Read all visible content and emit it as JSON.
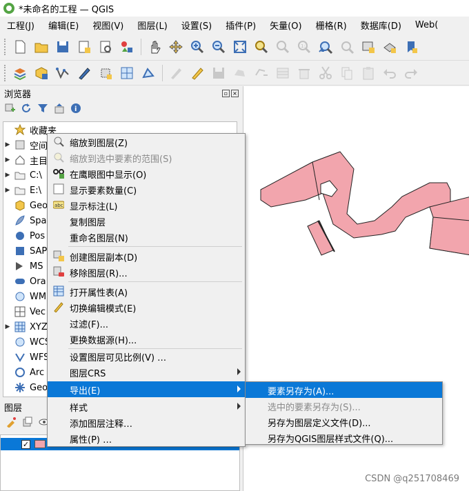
{
  "window": {
    "title": "*未命名的工程 — QGIS"
  },
  "menubar": [
    "工程(J)",
    "编辑(E)",
    "视图(V)",
    "图层(L)",
    "设置(S)",
    "插件(P)",
    "矢量(O)",
    "栅格(R)",
    "数据库(D)",
    "Web("
  ],
  "browser_panel": {
    "title": "浏览器",
    "items": [
      "收藏夹",
      "空间",
      "主目",
      "C:\\",
      "E:\\",
      "Geo",
      "Spa",
      "Pos",
      "SAP",
      "MS",
      "Ora",
      "WMS",
      "Vec",
      "XYZ",
      "WCS",
      "WFS",
      "Arc",
      "Geo"
    ]
  },
  "layers_panel": {
    "title": "图层"
  },
  "context_menu": {
    "items": [
      {
        "label": "缩放到图层(Z)",
        "icon": "zoom-layer-icon",
        "enabled": true
      },
      {
        "label": "缩放到选中要素的范围(S)",
        "icon": "zoom-selection-icon",
        "enabled": false
      },
      {
        "label": "在鹰眼图中显示(O)",
        "icon": "overview-icon",
        "enabled": true
      },
      {
        "label": "显示要素数量(C)",
        "icon": "checkbox-icon",
        "enabled": true
      },
      {
        "label": "显示标注(L)",
        "icon": "label-icon",
        "enabled": true
      },
      {
        "label": "复制图层",
        "icon": "",
        "enabled": true
      },
      {
        "label": "重命名图层(N)",
        "icon": "",
        "enabled": true
      },
      {
        "label": "创建图层副本(D)",
        "icon": "duplicate-icon",
        "enabled": true
      },
      {
        "label": "移除图层(R)...",
        "icon": "remove-icon",
        "enabled": true
      },
      {
        "label": "打开属性表(A)",
        "icon": "table-icon",
        "enabled": true
      },
      {
        "label": "切换编辑模式(E)",
        "icon": "pencil-icon",
        "enabled": true
      },
      {
        "label": "过滤(F)...",
        "icon": "",
        "enabled": true
      },
      {
        "label": "更换数据源(H)...",
        "icon": "",
        "enabled": true
      },
      {
        "label": "设置图层可见比例(V) …",
        "icon": "",
        "enabled": true
      },
      {
        "label": "图层CRS",
        "icon": "",
        "enabled": true,
        "submenu": true
      },
      {
        "label": "导出(E)",
        "icon": "",
        "enabled": true,
        "submenu": true,
        "highlighted": true
      },
      {
        "label": "样式",
        "icon": "",
        "enabled": true,
        "submenu": true
      },
      {
        "label": "添加图层注释…",
        "icon": "",
        "enabled": true
      },
      {
        "label": "属性(P) …",
        "icon": "",
        "enabled": true
      }
    ]
  },
  "export_submenu": {
    "items": [
      {
        "label": "要素另存为(A)...",
        "highlighted": true,
        "enabled": true
      },
      {
        "label": "选中的要素另存为(S)...",
        "enabled": false
      },
      {
        "label": "另存为图层定义文件(D)...",
        "enabled": true
      },
      {
        "label": "另存为QGIS图层样式文件(Q)...",
        "enabled": true
      }
    ]
  },
  "map": {
    "polygon_fill": "#f2a5ad",
    "polygon_stroke": "#222222"
  },
  "watermark": "CSDN @q251708469"
}
